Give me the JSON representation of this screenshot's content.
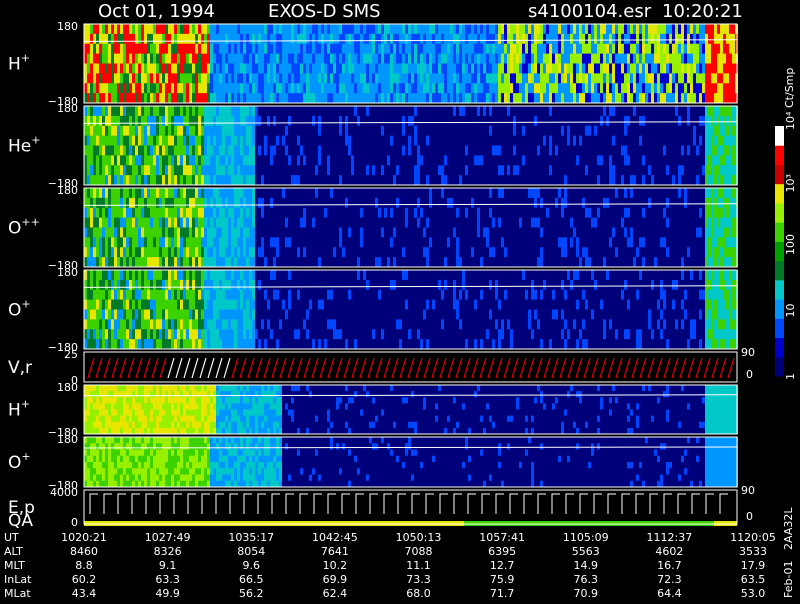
{
  "header": {
    "date": "Oct 01, 1994",
    "instrument": "EXOS-D SMS",
    "file": "s4100104.esr",
    "time": "10:20:21"
  },
  "colorbar": {
    "unit": "Ct/Smp",
    "ticks": [
      {
        "label": "1",
        "value": 1
      },
      {
        "label": "10",
        "value": 10
      },
      {
        "label": "100",
        "value": 100
      },
      {
        "label": "10³",
        "value": 1000
      },
      {
        "label": "10⁴",
        "value": 10000
      }
    ],
    "colors": [
      "#00007a",
      "#0000cc",
      "#0046ff",
      "#0096ff",
      "#00c8c8",
      "#007a28",
      "#00a000",
      "#3cd200",
      "#96f000",
      "#e6e600",
      "#c80000",
      "#ff0000",
      "#ffffff"
    ]
  },
  "panels": [
    {
      "id": "h-plus",
      "label": "H",
      "sup": "+",
      "ymax": "180",
      "ymin": "−180"
    },
    {
      "id": "he-plus",
      "label": "He",
      "sup": "+",
      "ymax": "180",
      "ymin": "−180"
    },
    {
      "id": "o-plus-plus",
      "label": "O",
      "sup": "++",
      "ymax": "180",
      "ymin": "−180"
    },
    {
      "id": "o-plus",
      "label": "O",
      "sup": "+",
      "ymax": "180",
      "ymin": "−180"
    },
    {
      "id": "vr",
      "label": "V,r",
      "sup": "",
      "ymax": "25",
      "ymin": "0",
      "rtop": "90",
      "rbot": "0"
    },
    {
      "id": "h-plus-2",
      "label": "H",
      "sup": "+",
      "ymax": "180",
      "ymin": "−180"
    },
    {
      "id": "o-plus-2",
      "label": "O",
      "sup": "+",
      "ymax": "180",
      "ymin": "−180"
    },
    {
      "id": "ep-qa",
      "label": "E,p",
      "label2": "QA",
      "sup": "",
      "ymax": "4000",
      "ymin": "0",
      "rtop": "90",
      "rbot": "0"
    }
  ],
  "ephemeris": {
    "rows": [
      {
        "name": "UT",
        "values": [
          "1020:21",
          "1027:49",
          "1035:17",
          "1042:45",
          "1050:13",
          "1057:41",
          "1105:09",
          "1112:37",
          "1120:05"
        ]
      },
      {
        "name": "ALT",
        "values": [
          "8460",
          "8326",
          "8054",
          "7641",
          "7088",
          "6395",
          "5563",
          "4602",
          "3533"
        ]
      },
      {
        "name": "MLT",
        "values": [
          "8.8",
          "9.1",
          "9.6",
          "10.2",
          "11.1",
          "12.7",
          "14.9",
          "16.7",
          "17.9"
        ]
      },
      {
        "name": "InLat",
        "values": [
          "60.2",
          "63.3",
          "66.5",
          "69.9",
          "73.3",
          "75.9",
          "76.3",
          "72.3",
          "63.5"
        ]
      },
      {
        "name": "MLat",
        "values": [
          "43.4",
          "49.9",
          "56.2",
          "62.4",
          "68.0",
          "71.7",
          "70.9",
          "64.4",
          "53.0"
        ]
      }
    ]
  },
  "footer": {
    "plot_date": "Feb-01",
    "code": "2AA32L"
  }
}
